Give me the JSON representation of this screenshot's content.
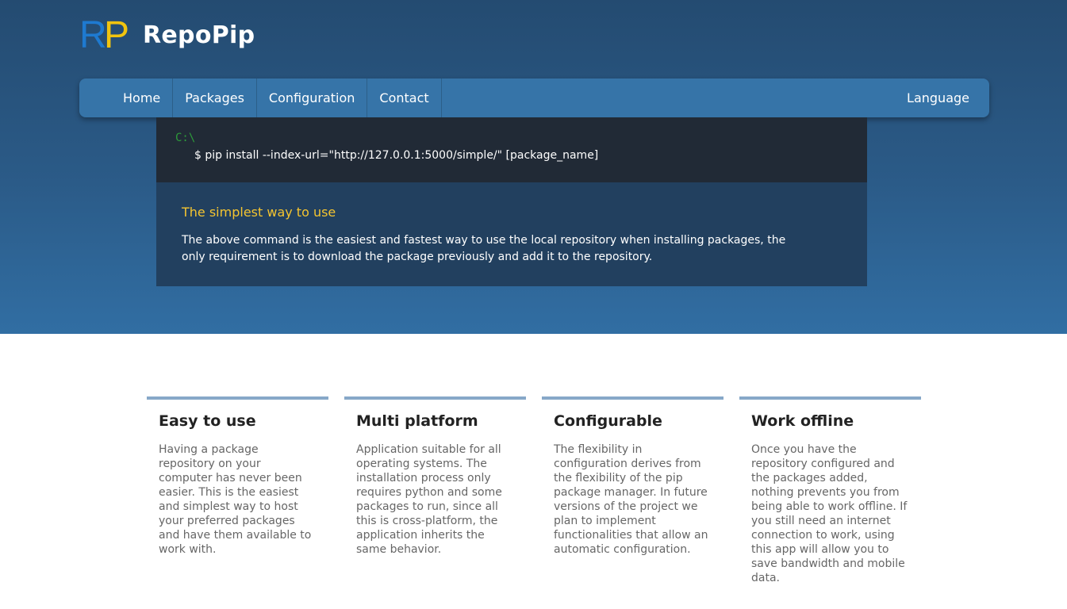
{
  "brand": {
    "logo_r": "R",
    "logo_p": "P",
    "name": "RepoPip"
  },
  "nav": {
    "items": [
      "Home",
      "Packages",
      "Configuration",
      "Contact"
    ],
    "language": "Language"
  },
  "terminal": {
    "prompt": "C:\\",
    "command": "$ pip install --index-url=\"http://127.0.0.1:5000/simple/\" [package_name]"
  },
  "info": {
    "title": "The simplest way to use",
    "text": "The above command is the easiest and fastest way to use the local repository when installing packages, the only requirement is to download the package previously and add it to the repository."
  },
  "features": [
    {
      "title": "Easy to use",
      "text": "Having a package repository on your computer has never been easier. This is the easiest and simplest way to host your preferred packages and have them available to work with."
    },
    {
      "title": "Multi platform",
      "text": "Application suitable for all operating systems. The installation process only requires python and some packages to run, since all this is cross-platform, the application inherits the same behavior."
    },
    {
      "title": "Configurable",
      "text": "The flexibility in configuration derives from the flexibility of the pip package manager. In future versions of the project we plan to implement functionalities that allow an automatic configuration."
    },
    {
      "title": "Work offline",
      "text": "Once you have the repository configured and the packages added, nothing prevents you from being able to work offline. If you still need an internet connection to work, using this app will allow you to save bandwidth and mobile data."
    }
  ],
  "colors": {
    "logo_r": "#1e7ad0",
    "logo_p": "#f1c40f",
    "navbar": "#3674a8",
    "terminal_bg": "#212a36",
    "prompt": "#2d9c3a",
    "info_bg": "#22405f",
    "info_title": "#f4c430",
    "feature_border": "#87a8c8"
  }
}
